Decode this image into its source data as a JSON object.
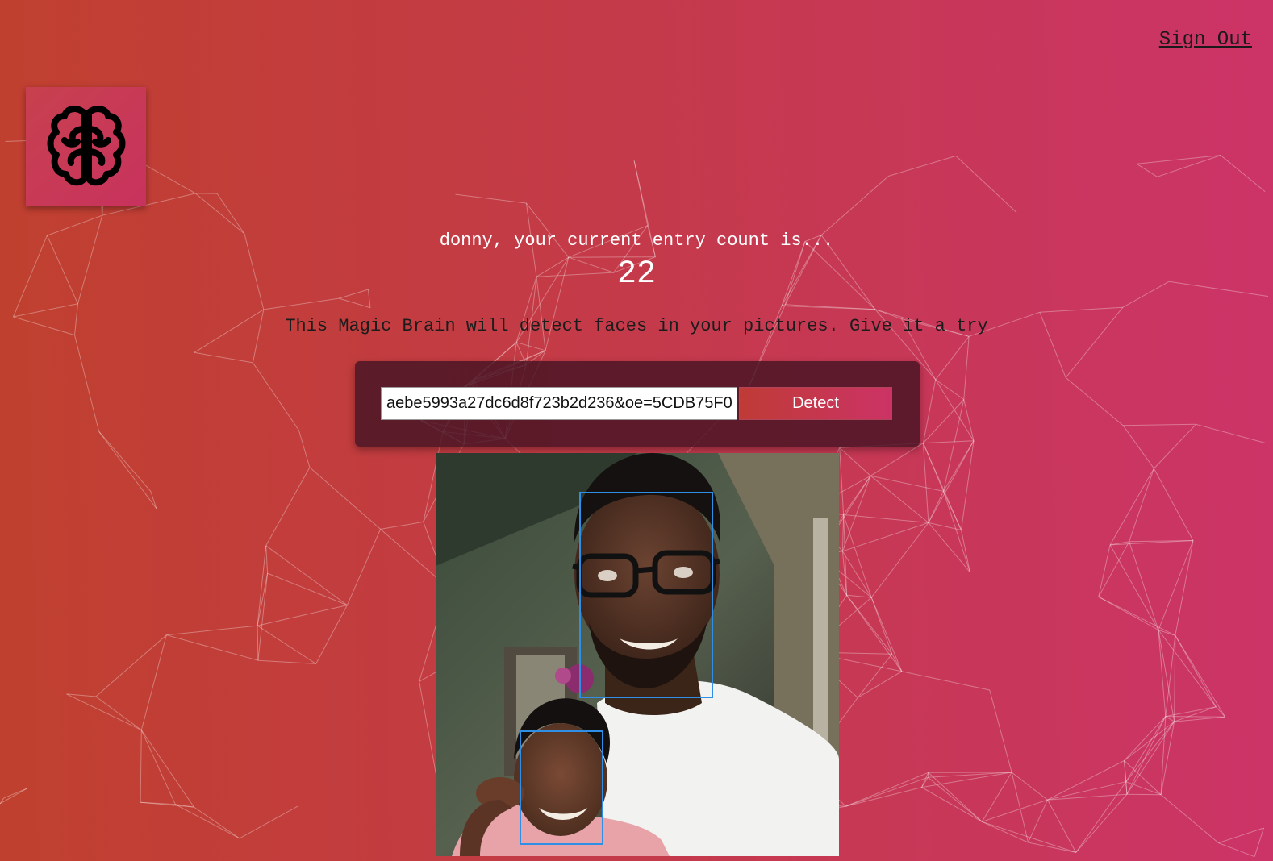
{
  "header": {
    "signout_label": "Sign Out"
  },
  "logo": {
    "icon": "brain-icon"
  },
  "rank": {
    "greeting": "donny, your current entry count is...",
    "count": "22"
  },
  "tagline": "This Magic Brain will detect faces in your pictures. Give it a try",
  "form": {
    "url_value": "aebe5993a27dc6d8f723b2d236&oe=5CDB75F0",
    "detect_label": "Detect"
  },
  "detection": {
    "face_count": 2
  },
  "colors": {
    "background_start": "#c0402f",
    "background_end": "#cc3468",
    "face_box": "#2f8fe6",
    "panel": "#461423"
  }
}
